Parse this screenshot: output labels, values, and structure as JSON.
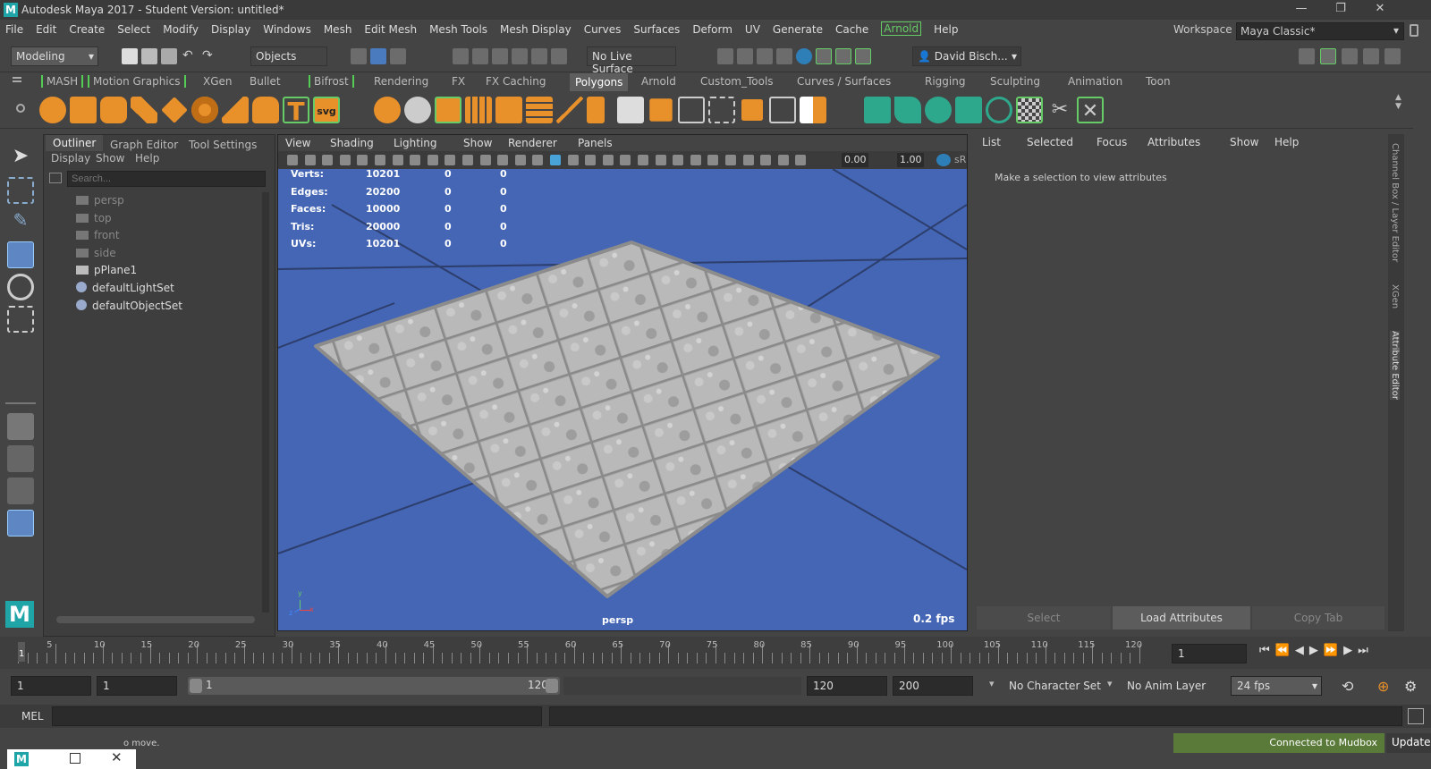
{
  "window": {
    "title": "Autodesk Maya 2017 - Student Version: untitled*",
    "minimize": "—",
    "restore": "❐",
    "close": "✕"
  },
  "menubar": {
    "items": [
      "File",
      "Edit",
      "Create",
      "Select",
      "Modify",
      "Display",
      "Windows",
      "Mesh",
      "Edit Mesh",
      "Mesh Tools",
      "Mesh Display",
      "Curves",
      "Surfaces",
      "Deform",
      "UV",
      "Generate",
      "Cache",
      "Arnold",
      "Help"
    ]
  },
  "workspace": {
    "label": "Workspace :",
    "value": "Maya Classic*"
  },
  "statusline": {
    "mode": "Modeling",
    "selection_mask": "Objects",
    "live_surface": "No Live Surface",
    "user": "David Bisch..."
  },
  "shelf_tabs": [
    "MASH",
    "Motion Graphics",
    "XGen",
    "Bullet",
    "Bifrost",
    "Rendering",
    "FX",
    "FX Caching",
    "Polygons",
    "Arnold",
    "Custom_Tools",
    "Curves / Surfaces",
    "Rigging",
    "Sculpting",
    "Animation",
    "Toon"
  ],
  "shelf_active": "Polygons",
  "shelf_icon_text": {
    "t": "T",
    "svg": "svg"
  },
  "outliner": {
    "tabs": [
      "Outliner",
      "Graph Editor",
      "Tool Settings"
    ],
    "menu": [
      "Display",
      "Show",
      "Help"
    ],
    "search_placeholder": "Search...",
    "items": [
      {
        "name": "persp",
        "dim": true
      },
      {
        "name": "top",
        "dim": true
      },
      {
        "name": "front",
        "dim": true
      },
      {
        "name": "side",
        "dim": true
      },
      {
        "name": "pPlane1",
        "dim": false
      },
      {
        "name": "defaultLightSet",
        "dim": false
      },
      {
        "name": "defaultObjectSet",
        "dim": false
      }
    ]
  },
  "viewport": {
    "menu": [
      "View",
      "Shading",
      "Lighting",
      "Show",
      "Renderer",
      "Panels"
    ],
    "near": "0.00",
    "far": "1.00",
    "srgb": "sR",
    "hud": [
      {
        "label": "Verts:",
        "v1": "10201",
        "v2": "0",
        "v3": "0"
      },
      {
        "label": "Edges:",
        "v1": "20200",
        "v2": "0",
        "v3": "0"
      },
      {
        "label": "Faces:",
        "v1": "10000",
        "v2": "0",
        "v3": "0"
      },
      {
        "label": "Tris:",
        "v1": "20000",
        "v2": "0",
        "v3": "0"
      },
      {
        "label": "UVs:",
        "v1": "10201",
        "v2": "0",
        "v3": "0"
      }
    ],
    "camera": "persp",
    "fps": "0.2 fps",
    "axis_y": "y",
    "axis_x": "x",
    "axis_z": "z"
  },
  "attribute_editor": {
    "menu": [
      "List",
      "Selected",
      "Focus",
      "Attributes",
      "Show",
      "Help"
    ],
    "message": "Make a selection to view attributes",
    "buttons": {
      "select": "Select",
      "load": "Load Attributes",
      "copy": "Copy Tab"
    }
  },
  "side_tabs": [
    "Channel Box / Layer Editor",
    "XGen",
    "Attribute Editor"
  ],
  "timeslider": {
    "ticks": [
      "5",
      "10",
      "15",
      "20",
      "25",
      "30",
      "35",
      "40",
      "45",
      "50",
      "55",
      "60",
      "65",
      "70",
      "75",
      "80",
      "85",
      "90",
      "95",
      "100",
      "105",
      "110",
      "115",
      "120"
    ],
    "current_marker": "1",
    "current_field": "1"
  },
  "range": {
    "start": "1",
    "anim_start": "1",
    "slider_start": "1",
    "slider_end": "120",
    "end": "120",
    "anim_end": "200",
    "character_set": "No Character Set",
    "anim_layer": "No Anim Layer",
    "fps": "24 fps"
  },
  "commandline": {
    "lang": "MEL"
  },
  "helpline": {
    "text": "o move.",
    "mudbox": "Connected to Mudbox",
    "update": "Update"
  },
  "colors": {
    "viewport_bg": "#4466b4",
    "accent_green": "#66cc66",
    "shelf_orange": "#e8902a",
    "shelf_teal": "#2ea88c",
    "mudbox_green": "#5a7a3a"
  }
}
